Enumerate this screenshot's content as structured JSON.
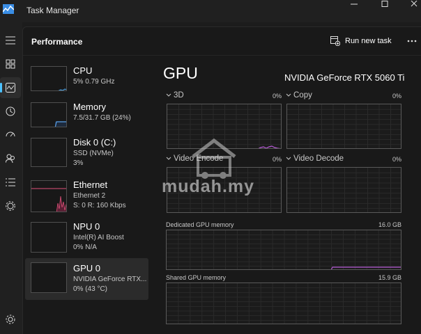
{
  "window": {
    "title": "Task Manager",
    "controls": [
      "minimize",
      "maximize",
      "close"
    ]
  },
  "rail": {
    "items": [
      "hamburger-icon",
      "processes-icon",
      "performance-icon",
      "app-history-icon",
      "startup-apps-icon",
      "users-icon",
      "details-icon",
      "services-icon",
      "settings-icon"
    ],
    "active": "performance-icon"
  },
  "header": {
    "title": "Performance",
    "run_new_task": "Run new task"
  },
  "devices": [
    {
      "name": "CPU",
      "line1": "5%  0.79 GHz",
      "line2": ""
    },
    {
      "name": "Memory",
      "line1": "7.5/31.7 GB (24%)",
      "line2": ""
    },
    {
      "name": "Disk 0 (C:)",
      "line1": "SSD (NVMe)",
      "line2": "3%"
    },
    {
      "name": "Ethernet",
      "line1": "Ethernet 2",
      "line2": "S: 0  R: 160 Kbps"
    },
    {
      "name": "NPU 0",
      "line1": "Intel(R) AI Boost",
      "line2": "0%  N/A"
    },
    {
      "name": "GPU 0",
      "line1": "NVIDIA GeForce RTX...",
      "line2": "0%  (43 °C)"
    }
  ],
  "detail": {
    "title": "GPU",
    "model": "NVIDIA GeForce RTX 5060 Ti",
    "engines": [
      {
        "label": "3D",
        "pct": "0%"
      },
      {
        "label": "Copy",
        "pct": "0%"
      },
      {
        "label": "Video Encode",
        "pct": "0%"
      },
      {
        "label": "Video Decode",
        "pct": "0%"
      }
    ],
    "dedicated": {
      "label": "Dedicated GPU memory",
      "value": "16.0 GB"
    },
    "shared": {
      "label": "Shared GPU memory",
      "value": "15.9 GB"
    }
  },
  "watermark": "mudah.my",
  "colors": {
    "background": "#191919",
    "accent": "#4cc2ff",
    "cpu_line": "#4a9fe0",
    "memory_line": "#5aa0e8",
    "ethernet_line": "#e0507a",
    "gpu_line": "#b65ad6"
  }
}
